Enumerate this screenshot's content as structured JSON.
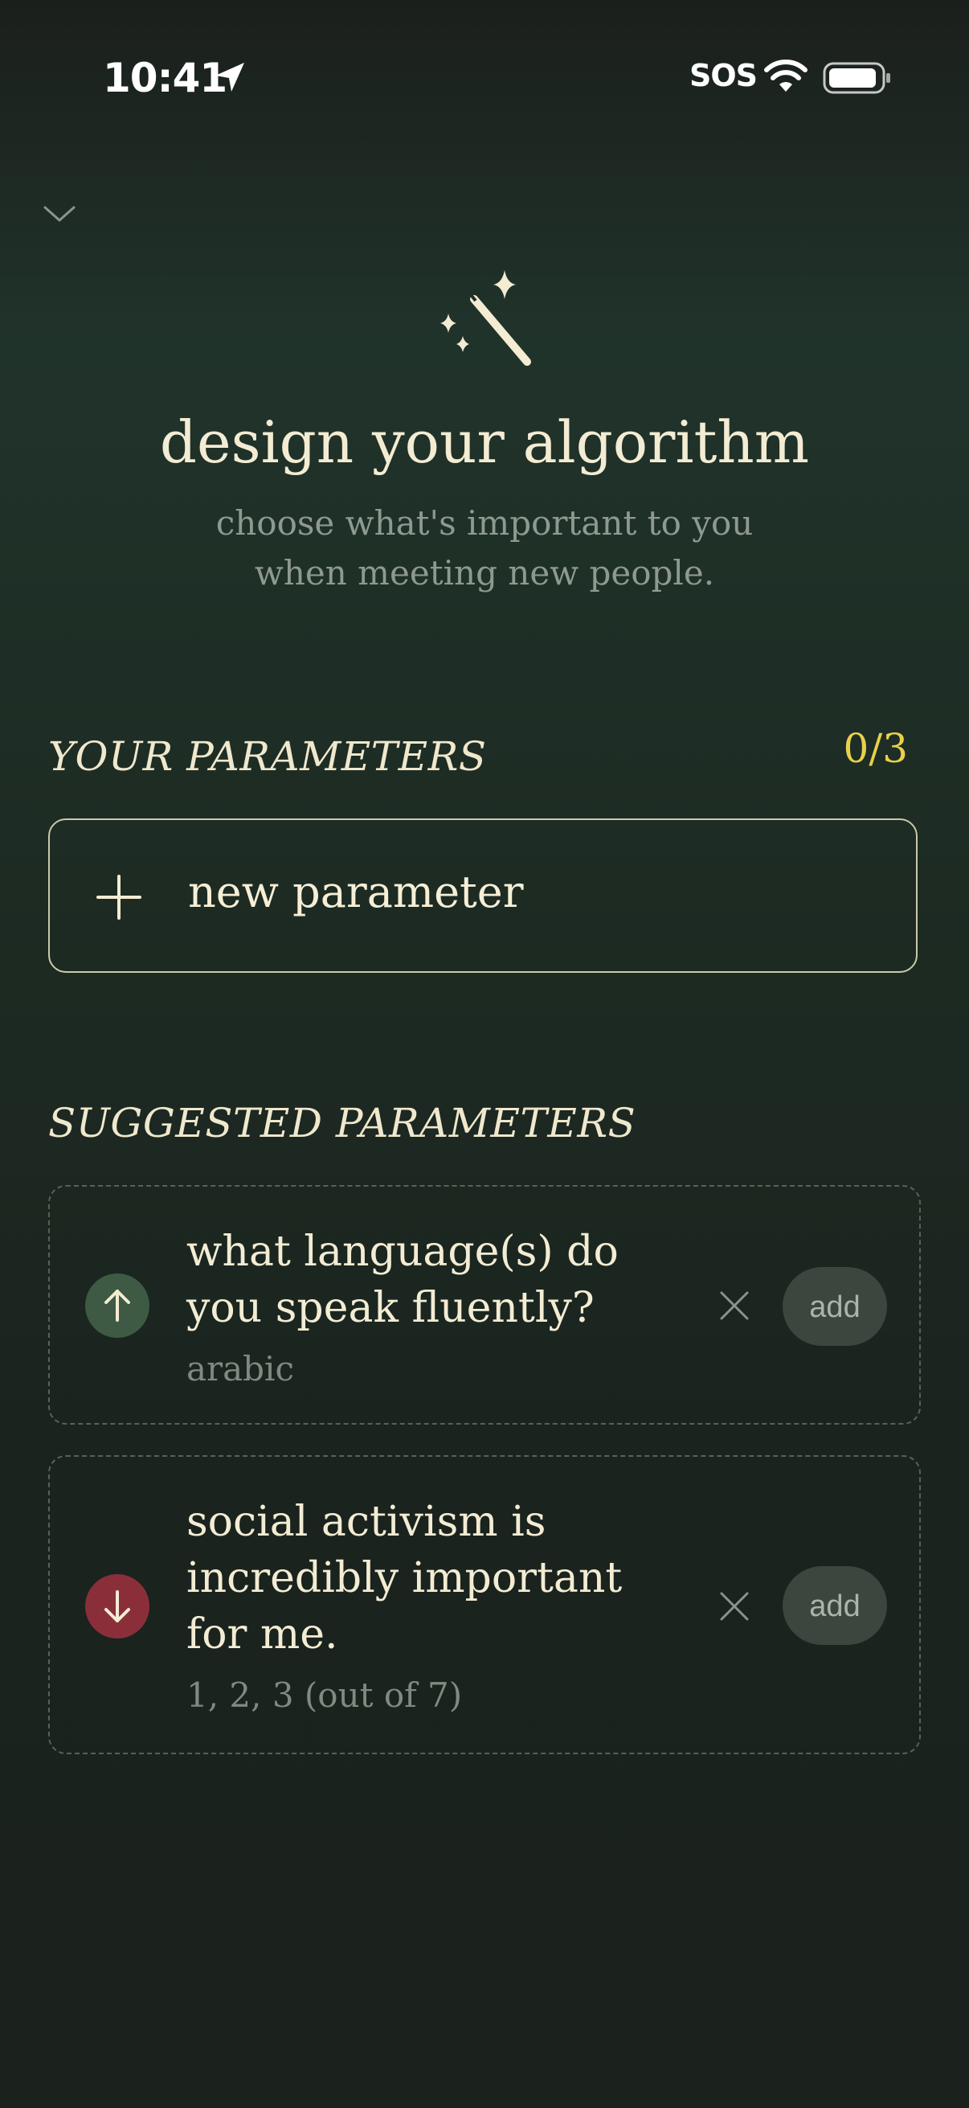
{
  "status_bar": {
    "time": "10:41",
    "carrier": "SOS",
    "icons": [
      "location-arrow-icon",
      "wifi-icon",
      "battery-icon"
    ]
  },
  "header": {
    "icon": "magic-wand-icon",
    "title": "design your algorithm",
    "subtitle_line1": "choose what's important to you",
    "subtitle_line2": "when meeting new people."
  },
  "your_parameters": {
    "label": "YOUR PARAMETERS",
    "count": "0/3",
    "new_button_label": "new parameter"
  },
  "suggested": {
    "label": "SUGGESTED PARAMETERS",
    "items": [
      {
        "direction": "up",
        "question_line1": "what language(s) do",
        "question_line2": "you speak fluently?",
        "answer": "arabic",
        "add_label": "add"
      },
      {
        "direction": "down",
        "question_line1": "social activism is",
        "question_line2": "incredibly important",
        "question_line3": "for me.",
        "answer": "1, 2, 3 (out of 7)",
        "add_label": "add"
      }
    ]
  },
  "colors": {
    "accent_yellow": "#e8d14a",
    "up_badge": "#3e5a44",
    "down_badge": "#8a2f3a",
    "text_primary": "#f3ecd3",
    "text_muted": "#8e9a8f"
  }
}
